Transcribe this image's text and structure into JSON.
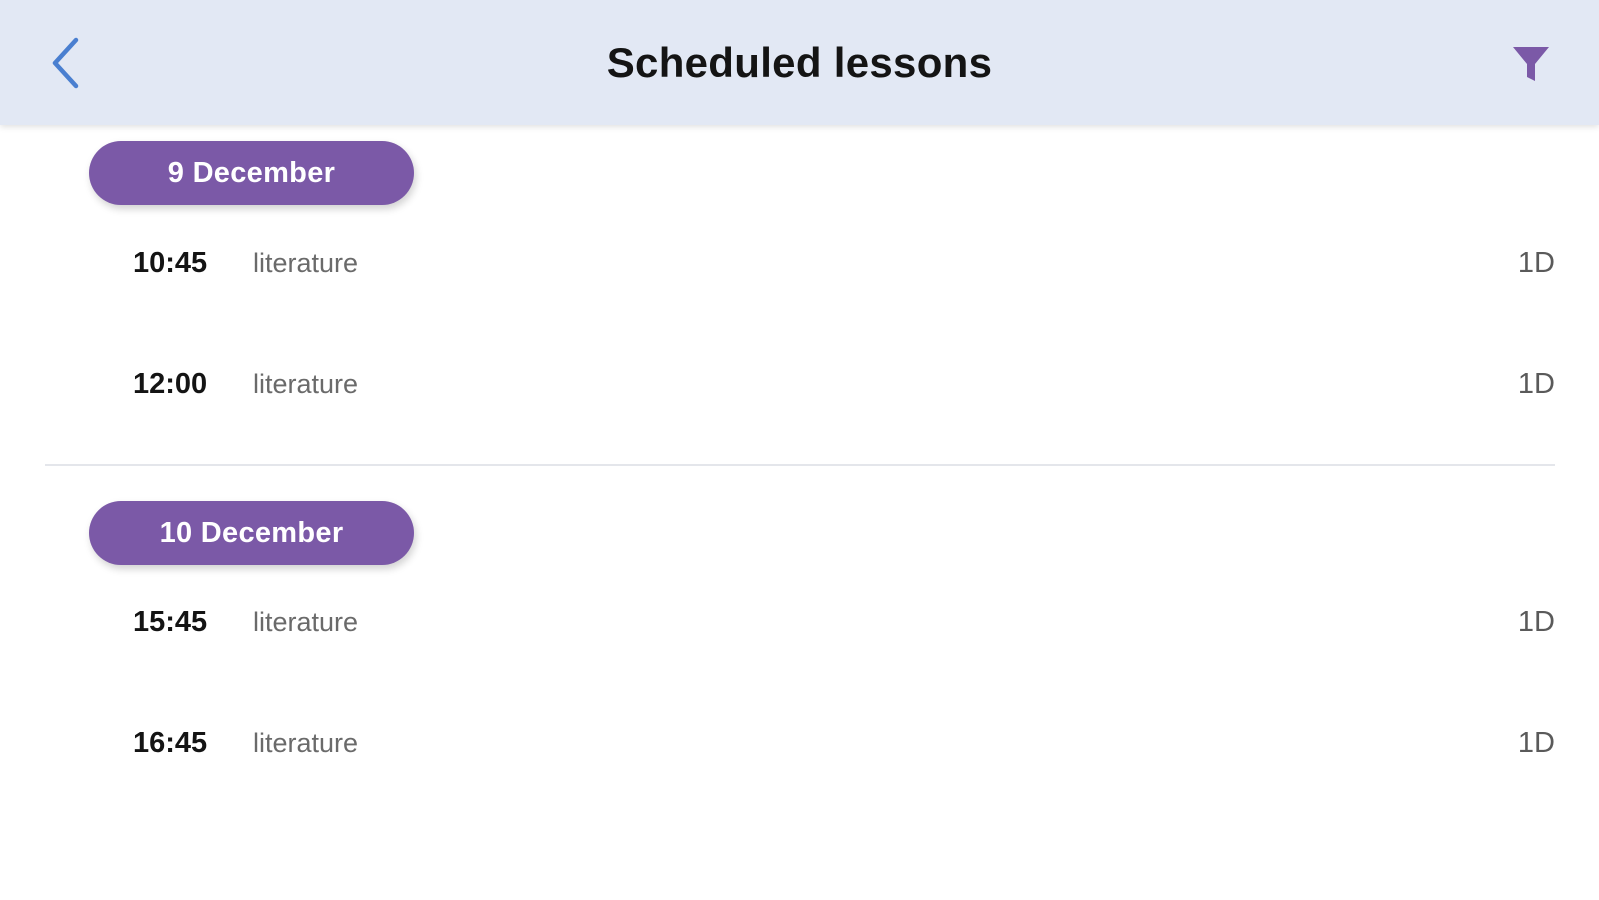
{
  "header": {
    "title": "Scheduled lessons",
    "back_icon": "chevron-left-icon",
    "filter_icon": "filter-icon",
    "back_color": "#4a7fd0",
    "filter_color": "#7b59a7"
  },
  "groups": [
    {
      "date": "9 December",
      "lessons": [
        {
          "time": "10:45",
          "subject": "literature",
          "class": "1D"
        },
        {
          "time": "12:00",
          "subject": "literature",
          "class": "1D"
        }
      ]
    },
    {
      "date": "10 December",
      "lessons": [
        {
          "time": "15:45",
          "subject": "literature",
          "class": "1D"
        },
        {
          "time": "16:45",
          "subject": "literature",
          "class": "1D"
        }
      ]
    }
  ],
  "colors": {
    "header_bg": "#e2e8f4",
    "pill_bg": "#7b59a7",
    "pill_text": "#ffffff"
  }
}
